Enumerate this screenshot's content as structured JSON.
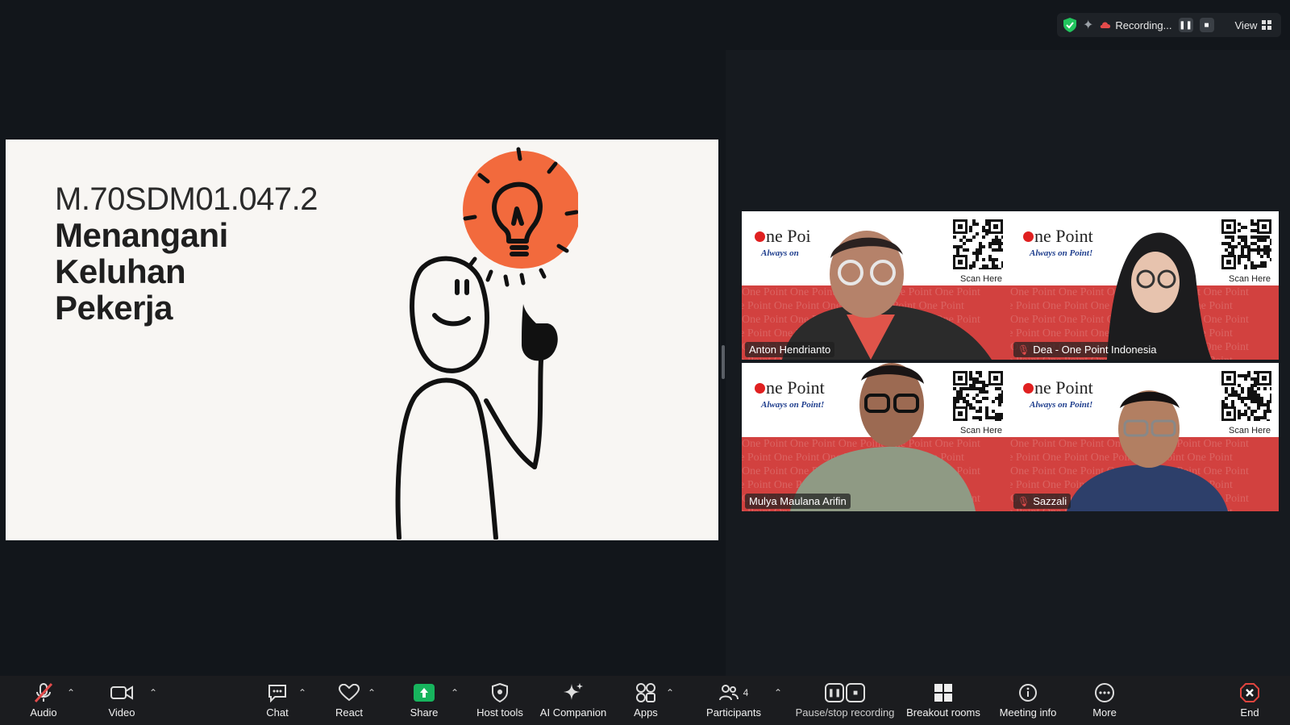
{
  "slide": {
    "code": "M.70SDM01.047.2",
    "title_lines": [
      "Menangani",
      "Keluhan",
      "Pekerja"
    ]
  },
  "recording_bar": {
    "status": "Recording...",
    "view_label": "View",
    "shield_color": "#22c55e"
  },
  "tiles": [
    {
      "name": "Anton Hendrianto",
      "muted": false,
      "active": true,
      "logo": "ne Poi",
      "tagline": "Always on",
      "scan": "Scan Here"
    },
    {
      "name": "Dea - One Point Indonesia",
      "muted": true,
      "active": false,
      "logo": "ne Point",
      "tagline": "Always on Point!",
      "scan": "Scan Here"
    },
    {
      "name": "Mulya Maulana Arifin",
      "muted": false,
      "active": false,
      "logo": "ne Point",
      "tagline": "Always on Point!",
      "scan": "Scan Here"
    },
    {
      "name": "Sazzali",
      "muted": true,
      "active": false,
      "logo": "ne Point",
      "tagline": "Always on Point!",
      "scan": "Scan Here"
    }
  ],
  "banner_pattern_text": "One Point One Point One Point One Point One Point",
  "toolbar": {
    "audio": "Audio",
    "video": "Video",
    "chat": "Chat",
    "react": "React",
    "share": "Share",
    "host_tools": "Host tools",
    "ai_companion": "AI Companion",
    "apps": "Apps",
    "participants": "Participants",
    "participants_count": "4",
    "pause_recording": "Pause/stop recording",
    "breakout_rooms": "Breakout rooms",
    "meeting_info": "Meeting info",
    "more": "More",
    "end": "End"
  },
  "colors": {
    "accent_green": "#17b45d",
    "active_outline": "#2fd67a",
    "banner_red": "#d2413f",
    "end_red": "#e0443e",
    "bulb_orange": "#f26a3d"
  }
}
